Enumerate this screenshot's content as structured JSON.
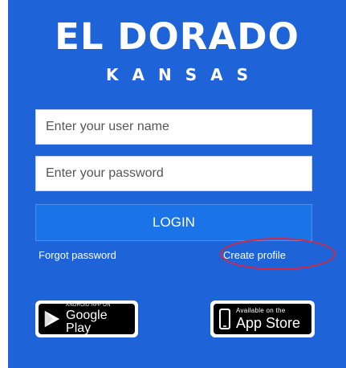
{
  "brand": {
    "title": "EL DORADO",
    "subtitle": "KANSAS"
  },
  "form": {
    "username_placeholder": "Enter your user name",
    "password_placeholder": "Enter your password",
    "login_label": "LOGIN",
    "forgot_label": "Forgot password",
    "create_label": "Create profile"
  },
  "stores": {
    "google_small": "ANDROID APP ON",
    "google_big": "Google Play",
    "apple_small": "Available on the",
    "apple_big": "App Store"
  },
  "colors": {
    "background": "#1f63d8",
    "button": "#1a74e8",
    "highlight": "#d8283f"
  },
  "icons": [
    "google-play-icon",
    "apple-phone-icon"
  ]
}
